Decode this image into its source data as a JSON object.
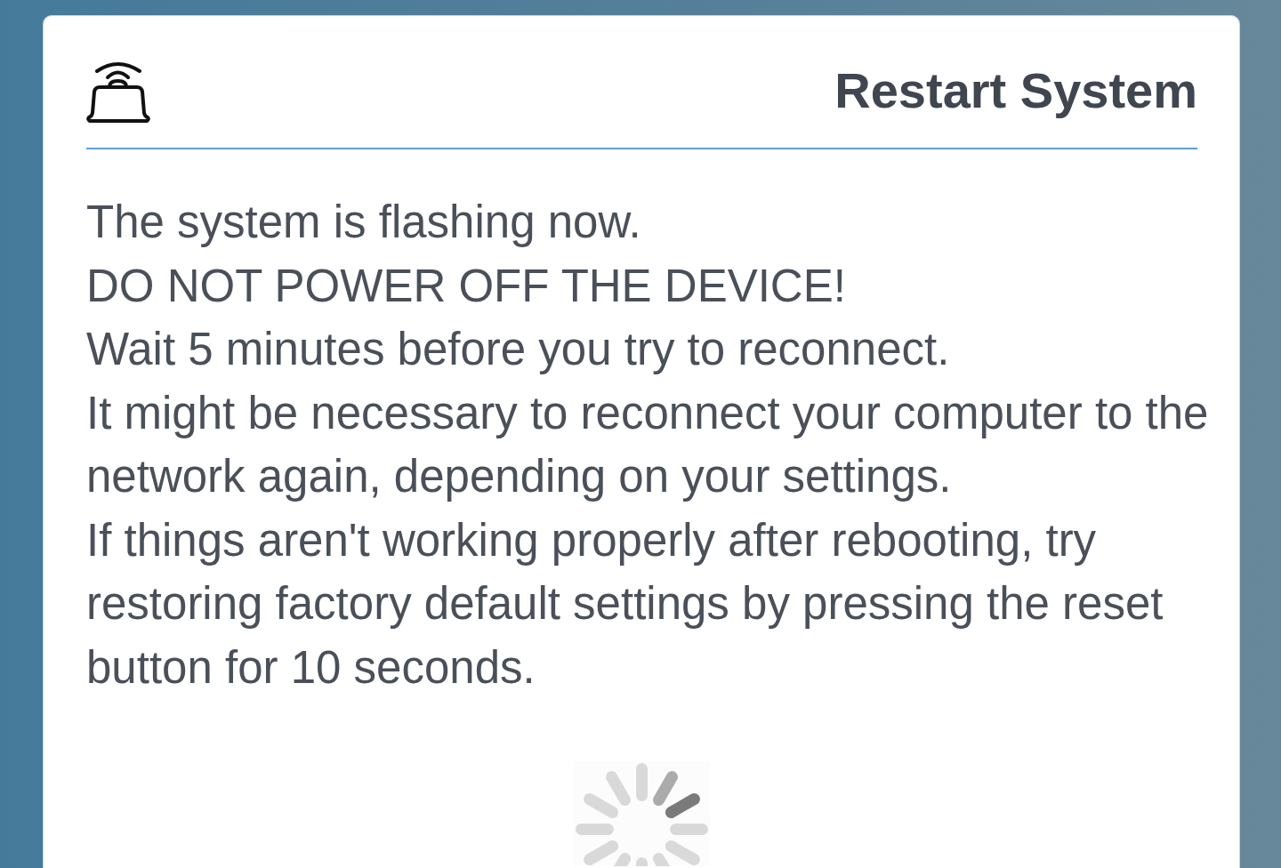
{
  "dialog": {
    "title": "Restart System",
    "message": [
      "The system is flashing now.",
      "DO NOT POWER OFF THE DEVICE!",
      "Wait 5 minutes before you try to reconnect.",
      "It might be necessary to reconnect your computer to the network again, depending on your settings.",
      "If things aren't working properly after rebooting, try restoring factory default settings by pressing the reset button for 10 seconds."
    ]
  }
}
